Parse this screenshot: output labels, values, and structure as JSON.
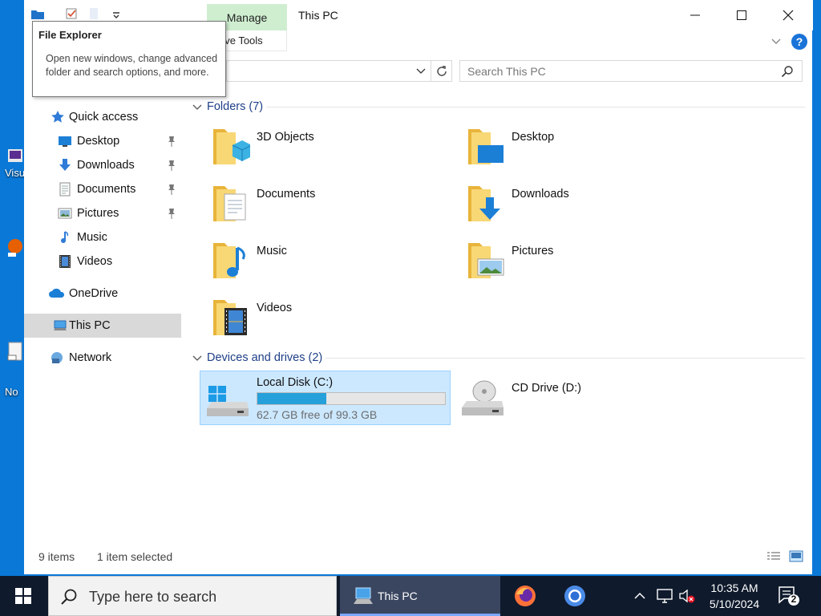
{
  "desktop": {
    "labels": [
      "Visu",
      "No"
    ]
  },
  "window": {
    "title": "This PC",
    "ribbon": {
      "manage_tab": "Manage",
      "drive_tools_tab": "Drive Tools",
      "drive_tools_visible": "rive Tools"
    }
  },
  "tooltip": {
    "title": "File Explorer",
    "body": "Open new windows, change advanced folder and search options, and more."
  },
  "search": {
    "placeholder": "Search This PC"
  },
  "nav": {
    "quick_access": "Quick access",
    "items": [
      {
        "label": "Desktop",
        "pinned": true
      },
      {
        "label": "Downloads",
        "pinned": true
      },
      {
        "label": "Documents",
        "pinned": true
      },
      {
        "label": "Pictures",
        "pinned": true
      },
      {
        "label": "Music",
        "pinned": false
      },
      {
        "label": "Videos",
        "pinned": false
      }
    ],
    "onedrive": "OneDrive",
    "this_pc": "This PC",
    "network": "Network"
  },
  "content": {
    "folders_header": "Folders (7)",
    "folders": [
      "3D Objects",
      "Desktop",
      "Documents",
      "Downloads",
      "Music",
      "Pictures",
      "Videos"
    ],
    "drives_header": "Devices and drives (2)",
    "drives": [
      {
        "label": "Local Disk (C:)",
        "free_text": "62.7 GB free of 99.3 GB",
        "used_fraction": 0.369
      },
      {
        "label": "CD Drive (D:)"
      }
    ]
  },
  "status": {
    "items": "9 items",
    "selected": "1 item selected"
  },
  "taskbar": {
    "search_placeholder": "Type here to search",
    "active_app": "This PC",
    "time": "10:35 AM",
    "date": "5/10/2024",
    "notification_count": "2"
  },
  "colors": {
    "accent": "#0a78d7",
    "taskbar": "#0f1a2c",
    "manage_tab": "#cfeed0",
    "selection": "#cce8ff"
  }
}
